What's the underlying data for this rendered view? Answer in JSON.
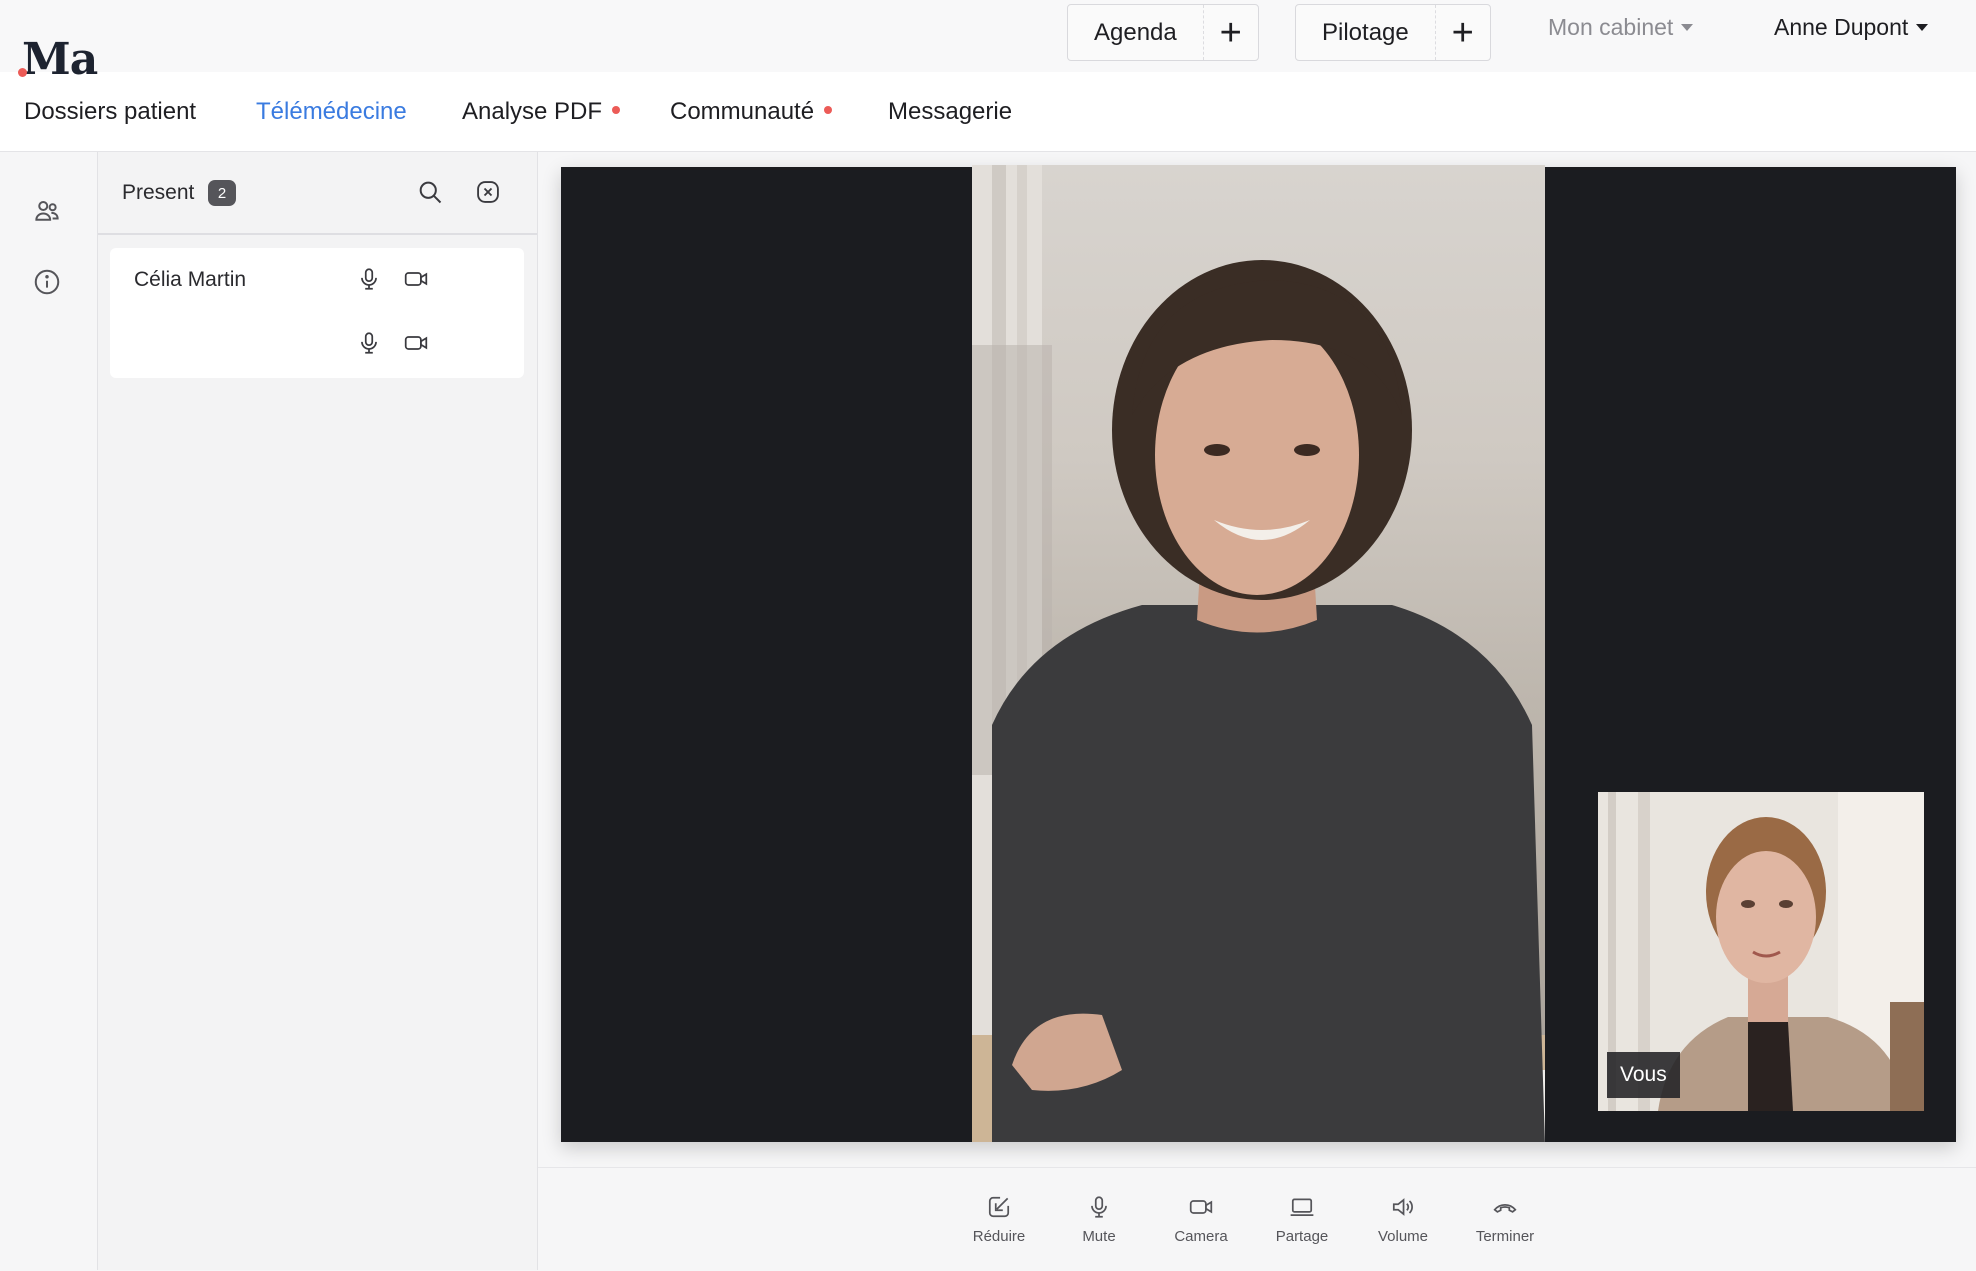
{
  "brand": {
    "logo_text": "Ma"
  },
  "header": {
    "quick_actions": [
      {
        "label": "Agenda",
        "plus": "+"
      },
      {
        "label": "Pilotage",
        "plus": "+"
      }
    ],
    "cabinet_menu": "Mon cabinet",
    "user_menu": "Anne Dupont"
  },
  "nav": {
    "tabs": [
      {
        "label": "Dossiers patient",
        "active": false,
        "notification": false
      },
      {
        "label": "Télémédecine",
        "active": true,
        "notification": false
      },
      {
        "label": "Analyse PDF",
        "active": false,
        "notification": true
      },
      {
        "label": "Communauté",
        "active": false,
        "notification": true
      },
      {
        "label": "Messagerie",
        "active": false,
        "notification": false
      }
    ]
  },
  "rail": {
    "icons": [
      "users-icon",
      "info-icon"
    ]
  },
  "participants": {
    "title": "Present",
    "count": "2",
    "list": [
      {
        "name": "Célia Martin",
        "mic": "microphone-icon",
        "camera": "camera-icon"
      },
      {
        "name": "",
        "mic": "microphone-icon",
        "camera": "camera-icon"
      }
    ]
  },
  "video": {
    "self_label": "Vous"
  },
  "toolbar": {
    "items": [
      {
        "label": "Réduire",
        "icon": "minimize-icon"
      },
      {
        "label": "Mute",
        "icon": "microphone-icon"
      },
      {
        "label": "Camera",
        "icon": "camera-icon"
      },
      {
        "label": "Partage",
        "icon": "screen-share-icon"
      },
      {
        "label": "Volume",
        "icon": "volume-icon"
      },
      {
        "label": "Terminer",
        "icon": "hang-up-icon"
      }
    ]
  },
  "colors": {
    "accent": "#3a7be0",
    "notification": "#ec5b57",
    "stage": "#1b1c20"
  }
}
